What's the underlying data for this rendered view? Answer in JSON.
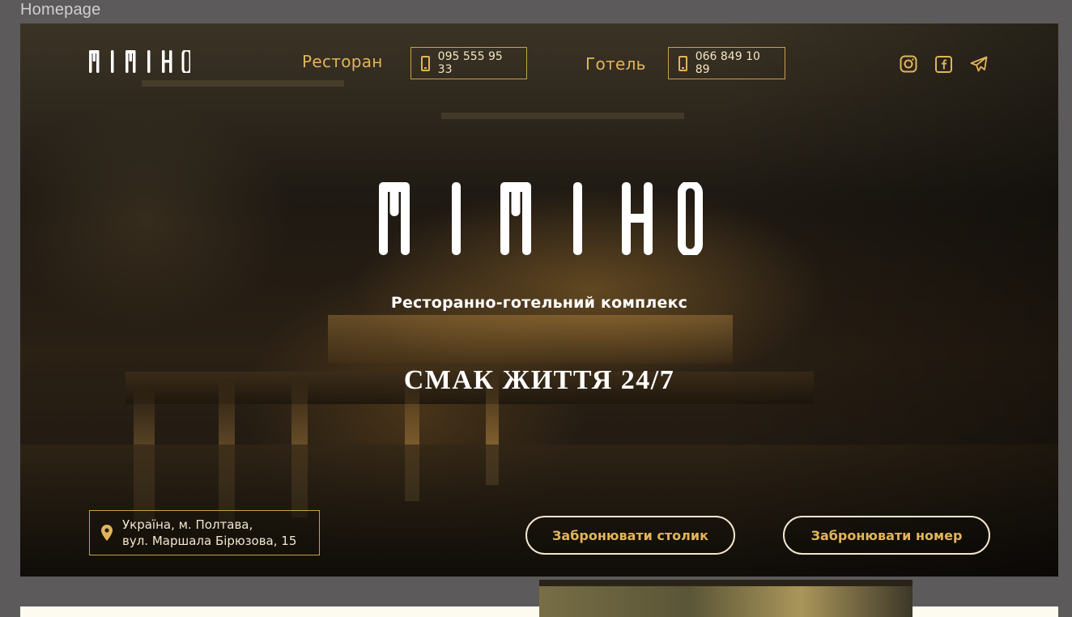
{
  "frame": {
    "label": "Homepage"
  },
  "header": {
    "logo_text": "MIMIHO",
    "nav": [
      {
        "label": "Ресторан",
        "phone": "095 555 95 33"
      },
      {
        "label": "Готель",
        "phone": "066 849 10 89"
      }
    ],
    "social_icons": [
      "instagram-icon",
      "facebook-icon",
      "telegram-icon"
    ]
  },
  "hero": {
    "brand": "MIMIHO",
    "subtitle": "Ресторанно-готельний комплекс",
    "tagline": "СМАК ЖИТТЯ 24/7",
    "address_line1": "Україна, м. Полтава,",
    "address_line2": "вул. Маршала Бірюзова, 15",
    "book_table": "Забронювати столик",
    "book_room": "Забронювати номер"
  },
  "colors": {
    "accent": "#e2b45a",
    "button_border": "#f2e7cf",
    "page_bg": "#5c5a5a"
  }
}
